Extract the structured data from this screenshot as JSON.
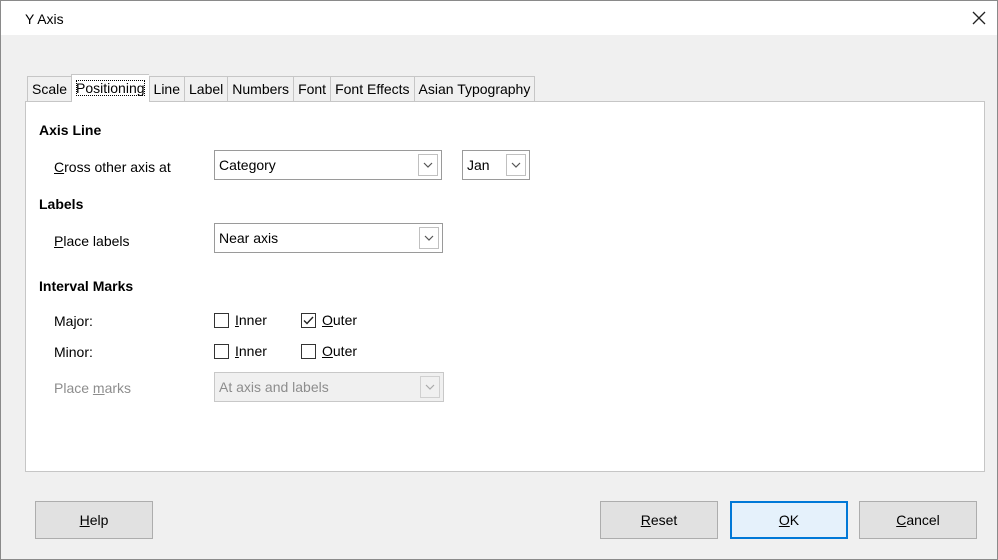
{
  "window": {
    "title": "Y Axis"
  },
  "tabs": [
    {
      "label": "Scale"
    },
    {
      "label": "Positioning",
      "active": true
    },
    {
      "label": "Line"
    },
    {
      "label": "Label"
    },
    {
      "label": "Numbers"
    },
    {
      "label": "Font"
    },
    {
      "label": "Font Effects"
    },
    {
      "label": "Asian Typography"
    }
  ],
  "axis_line": {
    "heading": "Axis Line",
    "cross_label_accel": "C",
    "cross_label_rest": "ross other axis at",
    "cross_value": "Category",
    "cross_category_value": "Jan"
  },
  "labels": {
    "heading": "Labels",
    "place_label_accel": "P",
    "place_label_rest": "lace labels",
    "place_value": "Near axis"
  },
  "interval_marks": {
    "heading": "Interval Marks",
    "major_label": "Major:",
    "minor_label": "Minor:",
    "inner_accel": "I",
    "inner_rest": "nner",
    "outer_accel": "O",
    "outer_rest": "uter",
    "major_inner": false,
    "major_outer": true,
    "minor_inner": false,
    "minor_outer": false,
    "place_marks_label_pre": "Place ",
    "place_marks_label_accel": "m",
    "place_marks_label_rest": "arks",
    "place_marks_value": "At axis and labels"
  },
  "buttons": {
    "help_accel": "H",
    "help_rest": "elp",
    "reset_accel": "R",
    "reset_rest": "eset",
    "ok_accel": "O",
    "ok_rest": "K",
    "cancel_accel": "C",
    "cancel_rest": "ancel"
  },
  "icons": {
    "close": "close-icon",
    "dropdown": "chevron-down-icon",
    "check": "checkmark-icon"
  },
  "colors": {
    "accent": "#0078d7",
    "panel": "#ffffff",
    "dialog_bg": "#f0f0f0",
    "disabled_text": "#8d8d8d"
  }
}
